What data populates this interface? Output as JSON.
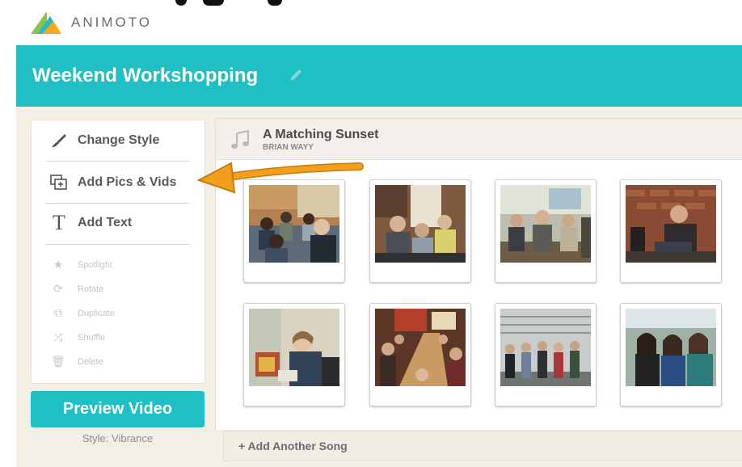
{
  "brand": {
    "name": "ANIMOTO"
  },
  "project": {
    "title": "Weekend Workshopping"
  },
  "sidebar": {
    "primary": [
      {
        "label": "Change Style",
        "icon": "brush-icon"
      },
      {
        "label": "Add Pics & Vids",
        "icon": "add-media-icon"
      },
      {
        "label": "Add Text",
        "icon": "text-icon"
      }
    ],
    "secondary": [
      {
        "label": "Spotlight",
        "icon": "star-icon"
      },
      {
        "label": "Rotate",
        "icon": "rotate-icon"
      },
      {
        "label": "Duplicate",
        "icon": "duplicate-icon"
      },
      {
        "label": "Shuffle",
        "icon": "shuffle-icon"
      },
      {
        "label": "Delete",
        "icon": "trash-icon"
      }
    ]
  },
  "song": {
    "title": "A Matching Sunset",
    "artist": "BRIAN WAYY"
  },
  "photos": [
    {
      "scene": "workshop circle"
    },
    {
      "scene": "group discussion"
    },
    {
      "scene": "seated attendees"
    },
    {
      "scene": "man on couch"
    },
    {
      "scene": "woman speaking"
    },
    {
      "scene": "dinner table"
    },
    {
      "scene": "outdoor group"
    },
    {
      "scene": "women smiling"
    }
  ],
  "actions": {
    "preview_label": "Preview Video",
    "style_label": "Style: Vibrance",
    "add_song_label": "+ Add Another Song"
  },
  "colors": {
    "accent": "#1fbfc3",
    "arrow": "#f2a01c",
    "background": "#f4efe6"
  }
}
